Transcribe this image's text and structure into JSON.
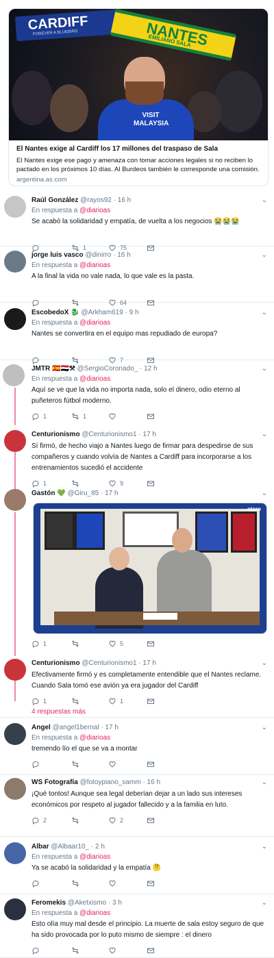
{
  "colors": {
    "accent": "#e0245e",
    "muted": "#657786",
    "text": "#14171a",
    "border": "#e6ecf0"
  },
  "card": {
    "image_scarf_left": "CARDIFF",
    "image_scarf_left_sub": "FOREVER A BLUEBIRD",
    "image_scarf_right": "NANTES",
    "image_scarf_right_sub": "EMILIANO SALA",
    "image_shirt": "VISIT MALAYSIA",
    "title": "El Nantes exige al Cardiff los 17 millones del traspaso de Sala",
    "description": "El Nantes exige ese pago y amenaza con tomar acciones legales si no reciben lo pactado en los próximos 10 días. Al Burdeos también le corresponde una comisión.",
    "domain": "argentina.as.com"
  },
  "reply_prefix": "En respuesta a",
  "reply_handle": "@diarioas",
  "tweets": [
    {
      "name": "Raúl González",
      "handle": "@rayos92",
      "time": "· 16 h",
      "text": "Se acabó la solidaridad y empatía, de vuelta a los negocios 😭😭😭",
      "replies": "",
      "retweets": "1",
      "likes": "75"
    },
    {
      "name": "jorge luis vasco",
      "handle": "@dinirro",
      "time": "· 16 h",
      "text": "A la final la vida no vale nada, lo que vale es la pasta.",
      "replies": "",
      "retweets": "",
      "likes": "64"
    },
    {
      "name": "EscobedoX 🐉",
      "handle": "@Arkham619",
      "time": "· 9 h",
      "text": "Nantes se convertira en el equipo mas repudiado de europa?",
      "replies": "",
      "retweets": "",
      "likes": "7"
    },
    {
      "name": "JMTR 🇪🇸🇪🇬⚒",
      "handle": "@SergioCoronado_",
      "time": "· 12 h",
      "text": "Aquí se ve que la vida no importa nada, solo el dinero, odio eterno al puñeteros fútbol moderno.",
      "replies": "1",
      "retweets": "1",
      "likes": ""
    },
    {
      "name": "Centurionismo",
      "handle": "@Centurionismo1",
      "time": "· 17 h",
      "text": "Sí firmó, de hecho viajo a Nantes luego de firmar para despedirse de sus compañeros y cuando volvía de Nantes a Cardiff para incorporarse a los entrenamientos sucedió el accidente",
      "replies": "1",
      "retweets": "",
      "likes": "9"
    },
    {
      "name": "Gastón 💚",
      "handle": "@Giru_85",
      "time": "· 17 h",
      "text": "",
      "replies": "1",
      "retweets": "",
      "likes": "5",
      "embed_tag": "etoro"
    },
    {
      "name": "Centurionismo",
      "handle": "@Centurionismo1",
      "time": "· 17 h",
      "text": "Efectivamente firmó y es completamente entendible que el Nantes reclame. Cuando Sala tomó ese avión ya era jugador del Cardiff",
      "replies": "1",
      "retweets": "",
      "likes": "1"
    },
    {
      "name": "Angel",
      "handle": "@angel1bernal",
      "time": "· 17 h",
      "text": "tremendo lío el que se va a montar",
      "replies": "",
      "retweets": "",
      "likes": ""
    },
    {
      "name": "WS Fotografía",
      "handle": "@fotoypiano_samm",
      "time": "· 16 h",
      "text": "¡Qué tontos! Aunque sea legal deberían dejar a un lado sus intereses económicos por respeto al jugador fallecido y a la familia en luto.",
      "replies": "2",
      "retweets": "",
      "likes": "2"
    },
    {
      "name": "Albar",
      "handle": "@Albaar10_",
      "time": "· 2 h",
      "text": "Ya se acabó la solidaridad y la empatía 🤔",
      "replies": "",
      "retweets": "",
      "likes": ""
    },
    {
      "name": "Feromekis",
      "handle": "@Aketxismo",
      "time": "· 3 h",
      "text": "Esto olía muy mal desde el principio. La muerte de sala estoy seguro de que ha sido provocada por lo puto mismo de siempre : el dinero",
      "replies": "",
      "retweets": "",
      "likes": ""
    }
  ],
  "more_replies": "4 respuestas más"
}
